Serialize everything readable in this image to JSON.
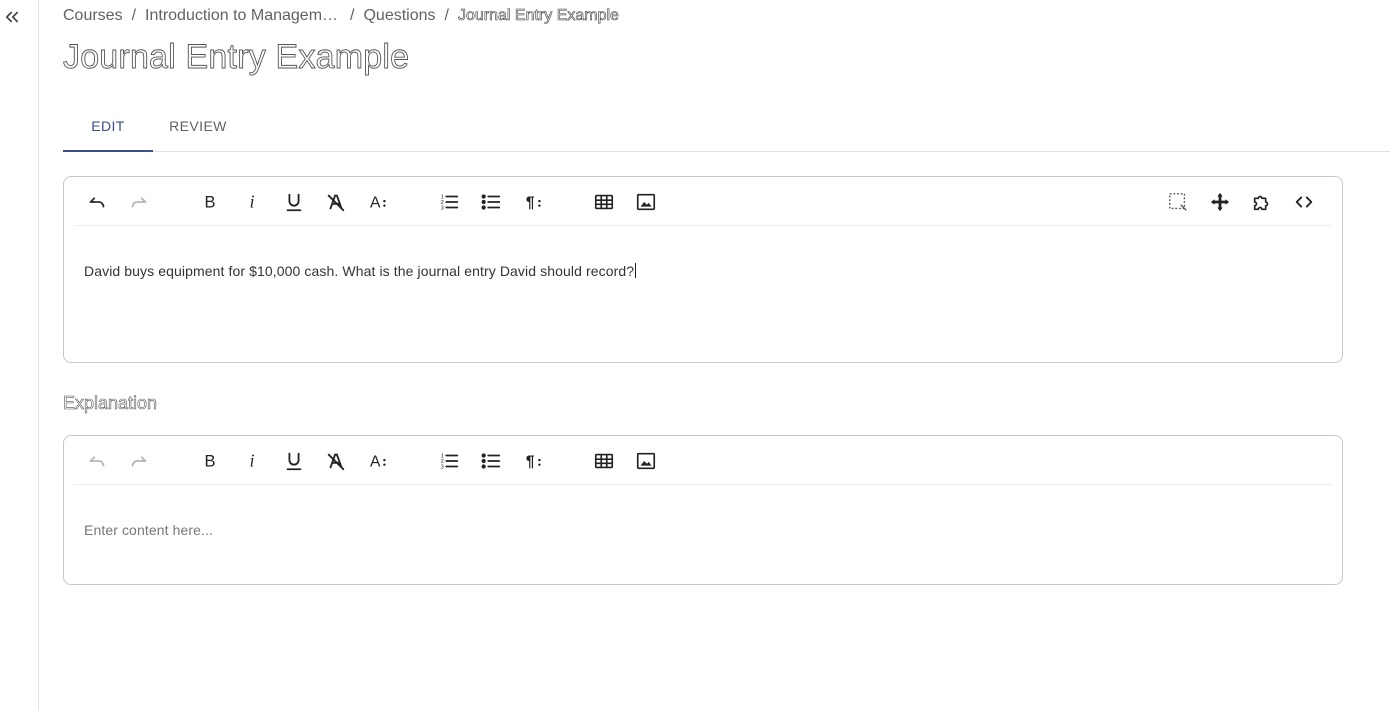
{
  "breadcrumb": {
    "items": [
      "Courses",
      "Introduction to Management Accounting",
      "Questions"
    ],
    "current": "Journal Entry Example",
    "separator": "/"
  },
  "page_title": "Journal Entry Example",
  "tabs": [
    {
      "label": "EDIT",
      "active": true
    },
    {
      "label": "REVIEW",
      "active": false
    }
  ],
  "question_editor": {
    "content": "David buys equipment for $10,000 cash. What is the journal entry David should record?",
    "toolbar_icons": [
      "undo-icon",
      "redo-icon",
      "bold-icon",
      "italic-icon",
      "underline-icon",
      "clear-format-icon",
      "font-size-icon",
      "ordered-list-icon",
      "bullet-list-icon",
      "paragraph-icon",
      "table-icon",
      "image-icon",
      "select-area-icon",
      "move-icon",
      "extension-icon",
      "code-icon"
    ]
  },
  "explanation": {
    "label": "Explanation",
    "placeholder": "Enter content here..."
  },
  "colors": {
    "accent": "#3b4f8a",
    "border": "#c8c8c8",
    "text": "#333333"
  }
}
